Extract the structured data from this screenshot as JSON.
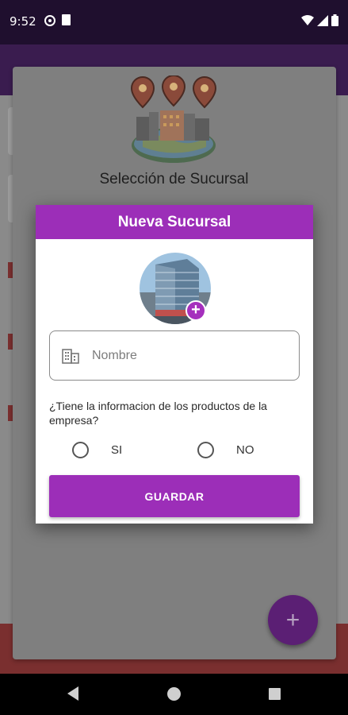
{
  "status_bar": {
    "time": "9:52",
    "icons": [
      "sync-icon",
      "sd-card-icon",
      "wifi-icon",
      "signal-icon",
      "battery-icon"
    ]
  },
  "selection": {
    "title": "Selección de Sucursal",
    "logo_icon": "city-globe-pins-icon"
  },
  "dialog": {
    "title": "Nueva Sucursal",
    "avatar_icon": "building-photo",
    "add_photo_label": "+",
    "name_field": {
      "placeholder": "Nombre",
      "value": "",
      "icon": "building-icon"
    },
    "question": "¿Tiene la informacion de los productos de la empresa?",
    "options": [
      {
        "label": "SI",
        "selected": false
      },
      {
        "label": "NO",
        "selected": false
      }
    ],
    "save_label": "GUARDAR"
  },
  "fab": {
    "label": "+"
  },
  "colors": {
    "primary": "#9c2eb8",
    "status_bar": "#1f0f2e",
    "app_bar": "#3a1c4f"
  }
}
